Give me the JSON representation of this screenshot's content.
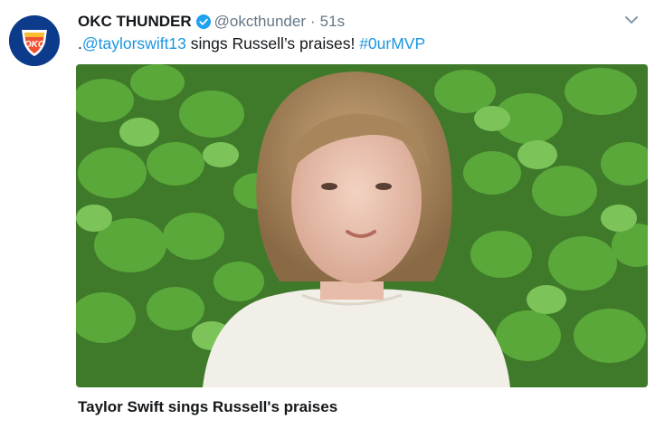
{
  "tweet": {
    "display_name": "OKC THUNDER",
    "handle": "@okcthunder",
    "separator": "·",
    "timestamp": "51s",
    "text_prefix": ".",
    "mention": "@taylorswift13",
    "text_middle": " sings Russell’s praises! ",
    "hashtag": "#0urMVP",
    "avatar_text": "OKC",
    "avatar_icon": "okc-thunder-logo-icon",
    "verified_icon": "verified-badge-icon",
    "menu_icon": "chevron-down-icon",
    "video_caption": "Taylor Swift sings Russell's praises",
    "colors": {
      "link": "#1b95e0",
      "secondary_text": "#657786",
      "primary_text": "#14171a",
      "verified": "#1da1f2",
      "leaf_green": "#5aa83a"
    }
  }
}
